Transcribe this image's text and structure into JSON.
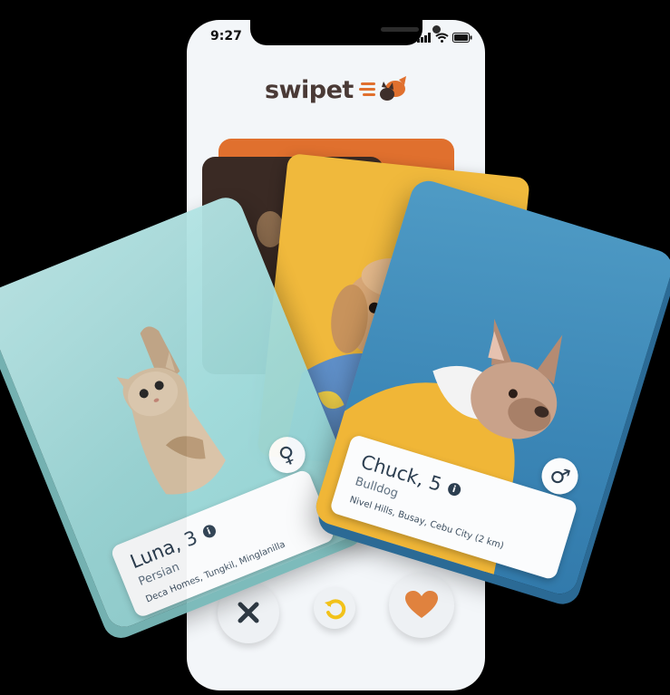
{
  "status_bar": {
    "time": "9:27"
  },
  "app": {
    "name": "swipet",
    "brand_color": "#e0702e",
    "logo_text_color": "#4a3a36"
  },
  "cards": {
    "luna": {
      "name": "Luna, 3",
      "breed": "Persian",
      "location": "Deca Homes, Tungkil, Minglanilla",
      "gender_symbol": "♀",
      "info_symbol": "i"
    },
    "chuck": {
      "name": "Chuck, 5",
      "breed": "Bulldog",
      "location": "Nivel Hills, Busay, Cebu City (2 km)",
      "gender_symbol": "♂",
      "info_symbol": "i"
    }
  },
  "actions": {
    "dislike_icon": "close-icon",
    "undo_icon": "undo-icon",
    "like_icon": "heart-icon",
    "undo_color": "#f2c21a",
    "like_color": "#e0823e"
  }
}
